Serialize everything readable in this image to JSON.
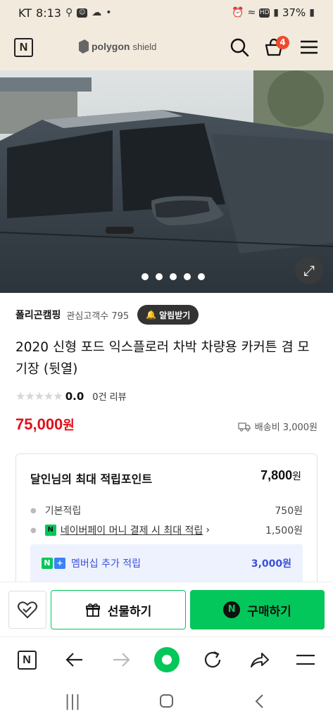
{
  "status_bar": {
    "carrier": "KT",
    "time": "8:13",
    "battery": "37%"
  },
  "header": {
    "brand": "polygon",
    "brand_suffix": "shield",
    "cart_count": "4"
  },
  "hero": {
    "slide_count": 5,
    "active_slide": 1
  },
  "store": {
    "name": "폴리곤캠핑",
    "followers": "관심고객수 795",
    "alarm_label": "알림받기"
  },
  "product": {
    "title": "2020 신형 포드 익스플로러 차박 차량용 카커튼 겸 모기장 (뒷열)",
    "rating": "0.0",
    "review_count": "0건 리뷰",
    "price": "75,000",
    "price_unit": "원",
    "shipping": "배송비 3,000원"
  },
  "points": {
    "title": "달인님의 최대 적립포인트",
    "total": "7,800",
    "total_unit": "원",
    "basic_label": "기본적립",
    "basic_amount": "750원",
    "npay_label": "네이버페이 머니 결제 시 최대 적립",
    "npay_amount": "1,500원",
    "member_label": "멤버십 추가 적립",
    "member_amount": "3,000원"
  },
  "actions": {
    "gift_label": "선물하기",
    "buy_label": "구매하기"
  },
  "colors": {
    "naver_green": "#03c75a",
    "price_red": "#e0101b",
    "header_bg": "#f1eadd",
    "membership_blue": "#3b51d8",
    "cart_badge": "#f04a2f"
  }
}
